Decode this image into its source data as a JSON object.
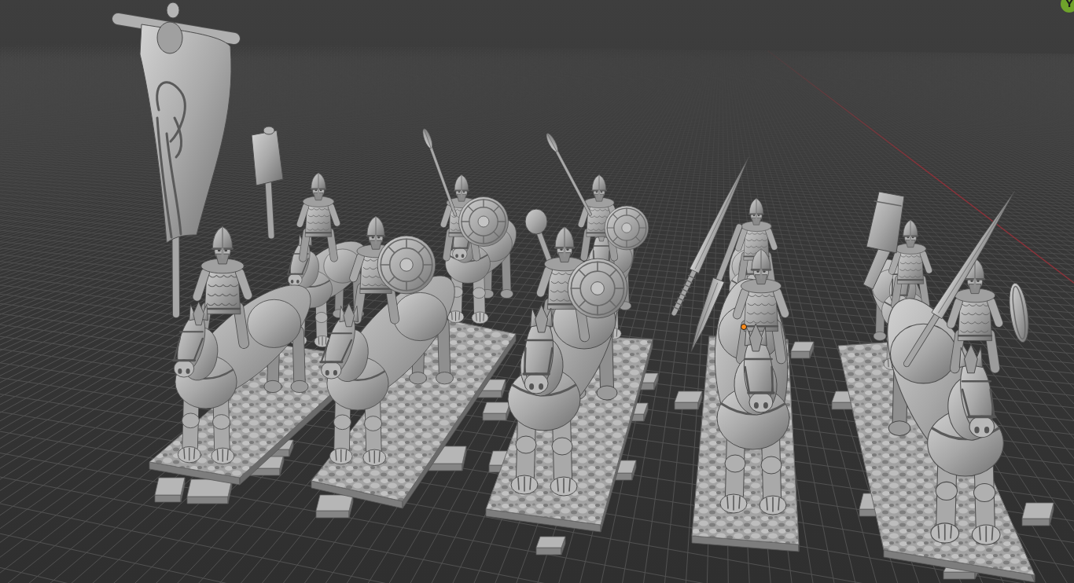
{
  "viewport": {
    "x_axis_line": true,
    "origin_marker": true
  },
  "navigation_gizmo": {
    "axes": [
      {
        "label": "Y",
        "color": "#6fa32b"
      }
    ]
  },
  "miniatures": [
    {
      "kind": "banner"
    },
    {
      "kind": "shield"
    },
    {
      "kind": "shield"
    },
    {
      "kind": "lance"
    },
    {
      "kind": "lance"
    }
  ]
}
